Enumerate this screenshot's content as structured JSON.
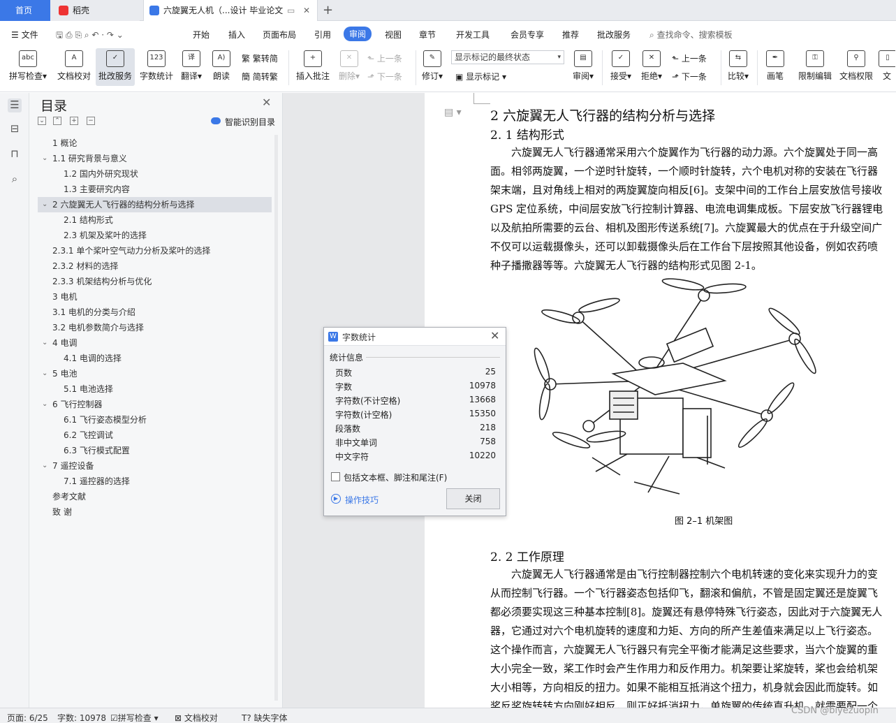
{
  "tabs": {
    "home": "首页",
    "daoke": "稻壳",
    "doc": "六旋翼无人机（...设计 毕业论文"
  },
  "menu": {
    "file": "文件",
    "items": [
      "开始",
      "插入",
      "页面布局",
      "引用",
      "审阅",
      "视图",
      "章节",
      "开发工具",
      "会员专享",
      "推荐",
      "批改服务"
    ],
    "search": "查找命令、搜索模板"
  },
  "ribbon": {
    "spell": "拼写检查",
    "doccheck": "文档校对",
    "pigai": "批改服务",
    "wordcount": "字数统计",
    "translate": "翻译",
    "read": "朗读",
    "fan2jian": "繁转简",
    "jian2fan": "简转繁",
    "insert_comment": "插入批注",
    "delete": "删除",
    "prev_comment": "上一条",
    "next_comment": "下一条",
    "revise": "修订",
    "markup_state": "显示标记的最终状态",
    "show_markup": "显示标记",
    "review": "审阅",
    "accept": "接受",
    "reject": "拒绝",
    "prev": "上一条",
    "next": "下一条",
    "compare": "比较",
    "pen": "画笔",
    "restrict": "限制编辑",
    "perm": "文档权限",
    "more": "文"
  },
  "toc": {
    "title": "目录",
    "smart": "智能识别目录",
    "items": [
      {
        "text": "1  概论",
        "indent": 0,
        "chev": false
      },
      {
        "text": "1.1  研究背景与意义",
        "indent": 0,
        "chev": true
      },
      {
        "text": "1.2  国内外研究现状",
        "indent": 1,
        "chev": false
      },
      {
        "text": "1.3  主要研究内容",
        "indent": 1,
        "chev": false
      },
      {
        "text": "2 六旋翼无人飞行器的结构分析与选择",
        "indent": 0,
        "chev": true,
        "sel": true
      },
      {
        "text": "2.1 结构形式",
        "indent": 1,
        "chev": false
      },
      {
        "text": "2.3 机架及桨叶的选择",
        "indent": 1,
        "chev": false
      },
      {
        "text": "2.3.1  单个桨叶空气动力分析及桨叶的选择",
        "indent": 0,
        "chev": false
      },
      {
        "text": "2.3.2 材料的选择",
        "indent": 0,
        "chev": false
      },
      {
        "text": "2.3.3 机架结构分析与优化",
        "indent": 0,
        "chev": false
      },
      {
        "text": "3 电机",
        "indent": 0,
        "chev": false
      },
      {
        "text": "3.1 电机的分类与介绍",
        "indent": 0,
        "chev": false
      },
      {
        "text": "3.2 电机参数简介与选择",
        "indent": 0,
        "chev": false
      },
      {
        "text": "4 电调",
        "indent": 0,
        "chev": true
      },
      {
        "text": "4.1 电调的选择",
        "indent": 1,
        "chev": false
      },
      {
        "text": "5 电池",
        "indent": 0,
        "chev": true
      },
      {
        "text": "5.1 电池选择",
        "indent": 1,
        "chev": false
      },
      {
        "text": "6 飞行控制器",
        "indent": 0,
        "chev": true
      },
      {
        "text": "6.1 飞行姿态模型分析",
        "indent": 1,
        "chev": false
      },
      {
        "text": "6.2 飞控调试",
        "indent": 1,
        "chev": false
      },
      {
        "text": "6.3 飞行模式配置",
        "indent": 1,
        "chev": false
      },
      {
        "text": "7 遥控设备",
        "indent": 0,
        "chev": true
      },
      {
        "text": "7.1 遥控器的选择",
        "indent": 1,
        "chev": false
      },
      {
        "text": "参考文献",
        "indent": 0,
        "chev": false
      },
      {
        "text": "致    谢",
        "indent": 0,
        "chev": false
      }
    ]
  },
  "doc": {
    "h1": "2 六旋翼无人飞行器的结构分析与选择",
    "h2a": "2. 1 结构形式",
    "p1": [
      "　　六旋翼无人飞行器通常采用六个旋翼作为飞行器的动力源。六个旋翼处于同一高",
      "面。相邻两旋翼，一个逆时针旋转，一个顺时针旋转，六个电机对称的安装在飞行器",
      "架末端，且对角线上相对的两旋翼旋向相反[6]。支架中间的工作台上层安放信号接收",
      "GPS 定位系统，中间层安放飞行控制计算器、电流电调集成板。下层安放飞行器锂电",
      "以及航拍所需要的云台、相机及图形传送系统[7]。六旋翼最大的优点在于升级空间广",
      "不仅可以运载摄像头，还可以卸载摄像头后在工作台下层按照其他设备，例如农药喷",
      "种子播撒器等等。六旋翼无人飞行器的结构形式见图 2-1。"
    ],
    "caption": "图 2–1    机架图",
    "h2b": "2. 2 工作原理",
    "p2": [
      "　　六旋翼无人飞行器通常是由飞行控制器控制六个电机转速的变化来实现升力的变",
      "从而控制飞行器。一个飞行器姿态包括仰飞，翻滚和偏航，不管是固定翼还是旋翼飞",
      "都必须要实现这三种基本控制[8]。旋翼还有悬停特殊飞行姿态，因此对于六旋翼无人",
      "器，它通过对六个电机旋转的速度和力矩、方向的所产生差值来满足以上飞行姿态。",
      "这个操作而言，六旋翼无人飞行器只有完全平衡才能满足这些要求，当六个旋翼的重",
      "大小完全一致，桨工作时会产生作用力和反作用力。机架要让桨旋转，桨也会给机架",
      "大小相等，方向相反的扭力。如果不能相互抵消这个扭力，机身就会因此而旋转。如",
      "桨反桨旋转转方向刚好相反，则正好抵消扭力，单旋翼的传统直升机，就需要配一个"
    ]
  },
  "dialog": {
    "title": "字数统计",
    "section": "统计信息",
    "rows": [
      {
        "label": "页数",
        "value": "25"
      },
      {
        "label": "字数",
        "value": "10978"
      },
      {
        "label": "字符数(不计空格)",
        "value": "13668"
      },
      {
        "label": "字符数(计空格)",
        "value": "15350"
      },
      {
        "label": "段落数",
        "value": "218"
      },
      {
        "label": "非中文单词",
        "value": "758"
      },
      {
        "label": "中文字符",
        "value": "10220"
      }
    ],
    "checkbox": "包括文本框、脚注和尾注(F)",
    "tips": "操作技巧",
    "close": "关闭"
  },
  "status": {
    "page": "页面: 6/25",
    "words": "字数: 10978",
    "spell": "拼写检查",
    "doccheck": "文档校对",
    "missing_font": "缺失字体",
    "watermark": "CSDN @biyezuopin"
  }
}
